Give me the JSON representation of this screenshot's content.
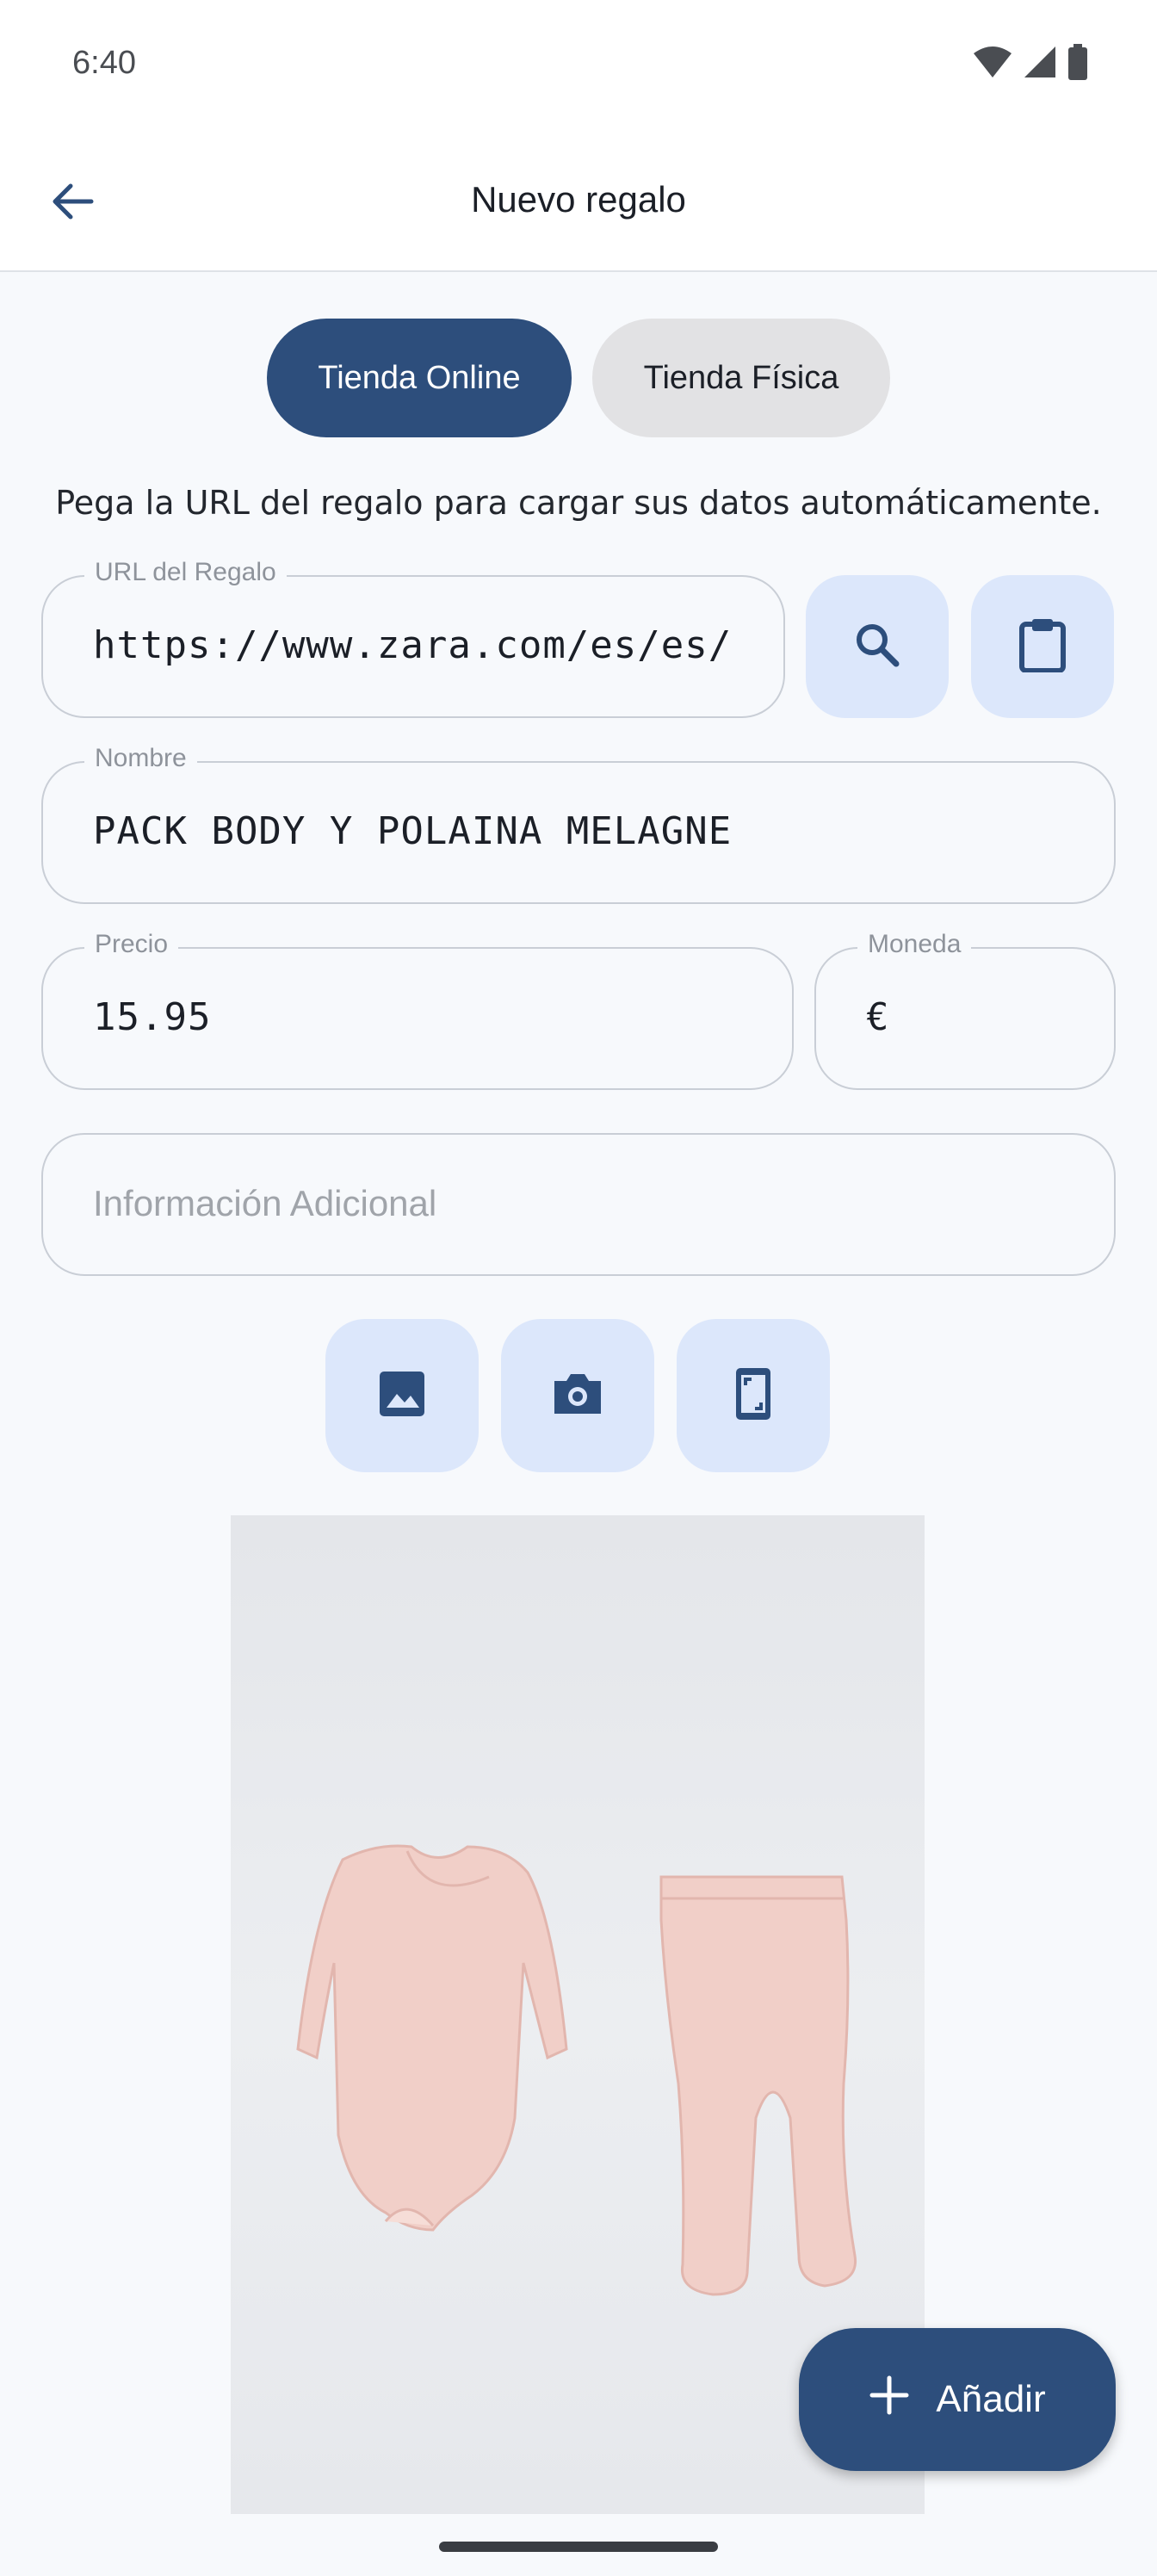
{
  "status_bar": {
    "time": "6:40",
    "icons": [
      "wifi-icon",
      "signal-icon",
      "battery-icon"
    ]
  },
  "app_bar": {
    "title": "Nuevo regalo",
    "back_icon": "arrow-left-icon"
  },
  "store_toggle": {
    "online_label": "Tienda Online",
    "physical_label": "Tienda Física",
    "selected": "online"
  },
  "helper_text": "Pega la URL del regalo para cargar sus datos automáticamente.",
  "form": {
    "url": {
      "label": "URL del Regalo",
      "value": "https://www.zara.com/es/es/pack-body-y-polaina"
    },
    "name": {
      "label": "Nombre",
      "value": "PACK BODY Y POLAINA MELAGNE"
    },
    "price": {
      "label": "Precio",
      "value": "15.95"
    },
    "currency": {
      "label": "Moneda",
      "value": "€"
    },
    "extra": {
      "placeholder": "Información Adicional"
    }
  },
  "url_actions": [
    "search-icon",
    "clipboard-icon"
  ],
  "image_actions": [
    "image-icon",
    "camera-icon",
    "screenshot-icon"
  ],
  "preview_image": {
    "description_icon": "product-photo"
  },
  "fab": {
    "label": "Añadir",
    "icon": "plus-icon"
  },
  "colors": {
    "primary": "#2d4e7c",
    "tonal_button": "#dce7fb",
    "background": "#f7f9fc"
  }
}
